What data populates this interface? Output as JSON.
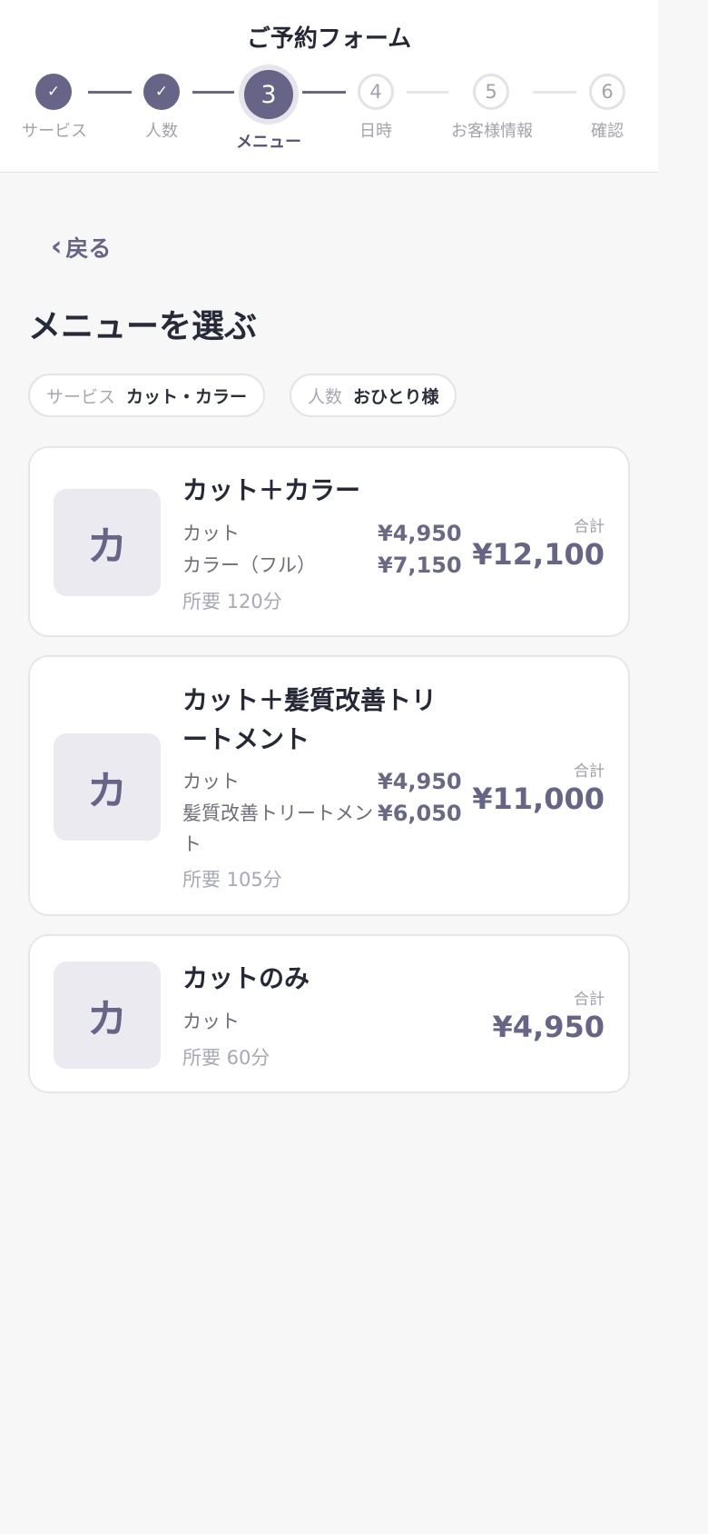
{
  "header": {
    "title": "ご予約フォーム"
  },
  "steps": [
    {
      "label": "サービス",
      "status": "done",
      "mark": "✓"
    },
    {
      "label": "人数",
      "status": "done",
      "mark": "✓"
    },
    {
      "label": "メニュー",
      "status": "current",
      "mark": "3"
    },
    {
      "label": "日時",
      "status": "todo",
      "mark": "4"
    },
    {
      "label": "お客様情報",
      "status": "todo",
      "mark": "5"
    },
    {
      "label": "確認",
      "status": "todo",
      "mark": "6"
    }
  ],
  "back_label": "戻る",
  "page_title": "メニューを選ぶ",
  "chips": [
    {
      "key": "サービス",
      "value": "カット・カラー"
    },
    {
      "key": "人数",
      "value": "おひとり様"
    }
  ],
  "menus": [
    {
      "thumb": "カ",
      "title": "カット＋カラー",
      "items": [
        {
          "name": "カット",
          "price": "¥4,950"
        },
        {
          "name": "カラー（フル）",
          "price": "¥7,150"
        }
      ],
      "duration": "所要 120分",
      "total_label": "合計",
      "total": "¥12,100"
    },
    {
      "thumb": "カ",
      "title": "カット＋髪質改善トリートメント",
      "items": [
        {
          "name": "カット",
          "price": "¥4,950"
        },
        {
          "name": "髪質改善トリートメント",
          "price": "¥6,050"
        }
      ],
      "duration": "所要 105分",
      "total_label": "合計",
      "total": "¥11,000"
    },
    {
      "thumb": "カ",
      "title": "カットのみ",
      "items": [
        {
          "name": "カット"
        }
      ],
      "duration": "所要 60分",
      "total_label": "合計",
      "total": "¥4,950"
    }
  ],
  "colors": {
    "accent": "#666487",
    "background": "#f8f7f8",
    "inactive": "#e3e2e8"
  }
}
